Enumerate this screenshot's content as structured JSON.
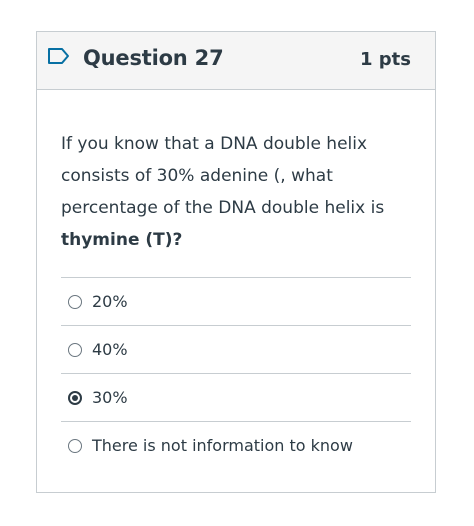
{
  "question": {
    "title": "Question 27",
    "points": "1 pts",
    "text_plain": "If you know that a DNA double helix consists of 30% adenine (, what percentage of the DNA double helix is ",
    "text_bold": "thymine (T)?"
  },
  "answers": [
    {
      "label": "20%",
      "selected": false
    },
    {
      "label": "40%",
      "selected": false
    },
    {
      "label": "30%",
      "selected": true
    },
    {
      "label": "There is not information to know",
      "selected": false
    }
  ],
  "colors": {
    "text": "#2d3b45",
    "border": "#c7cdd1",
    "header_bg": "#f5f5f5",
    "flag": "#0770a3"
  }
}
